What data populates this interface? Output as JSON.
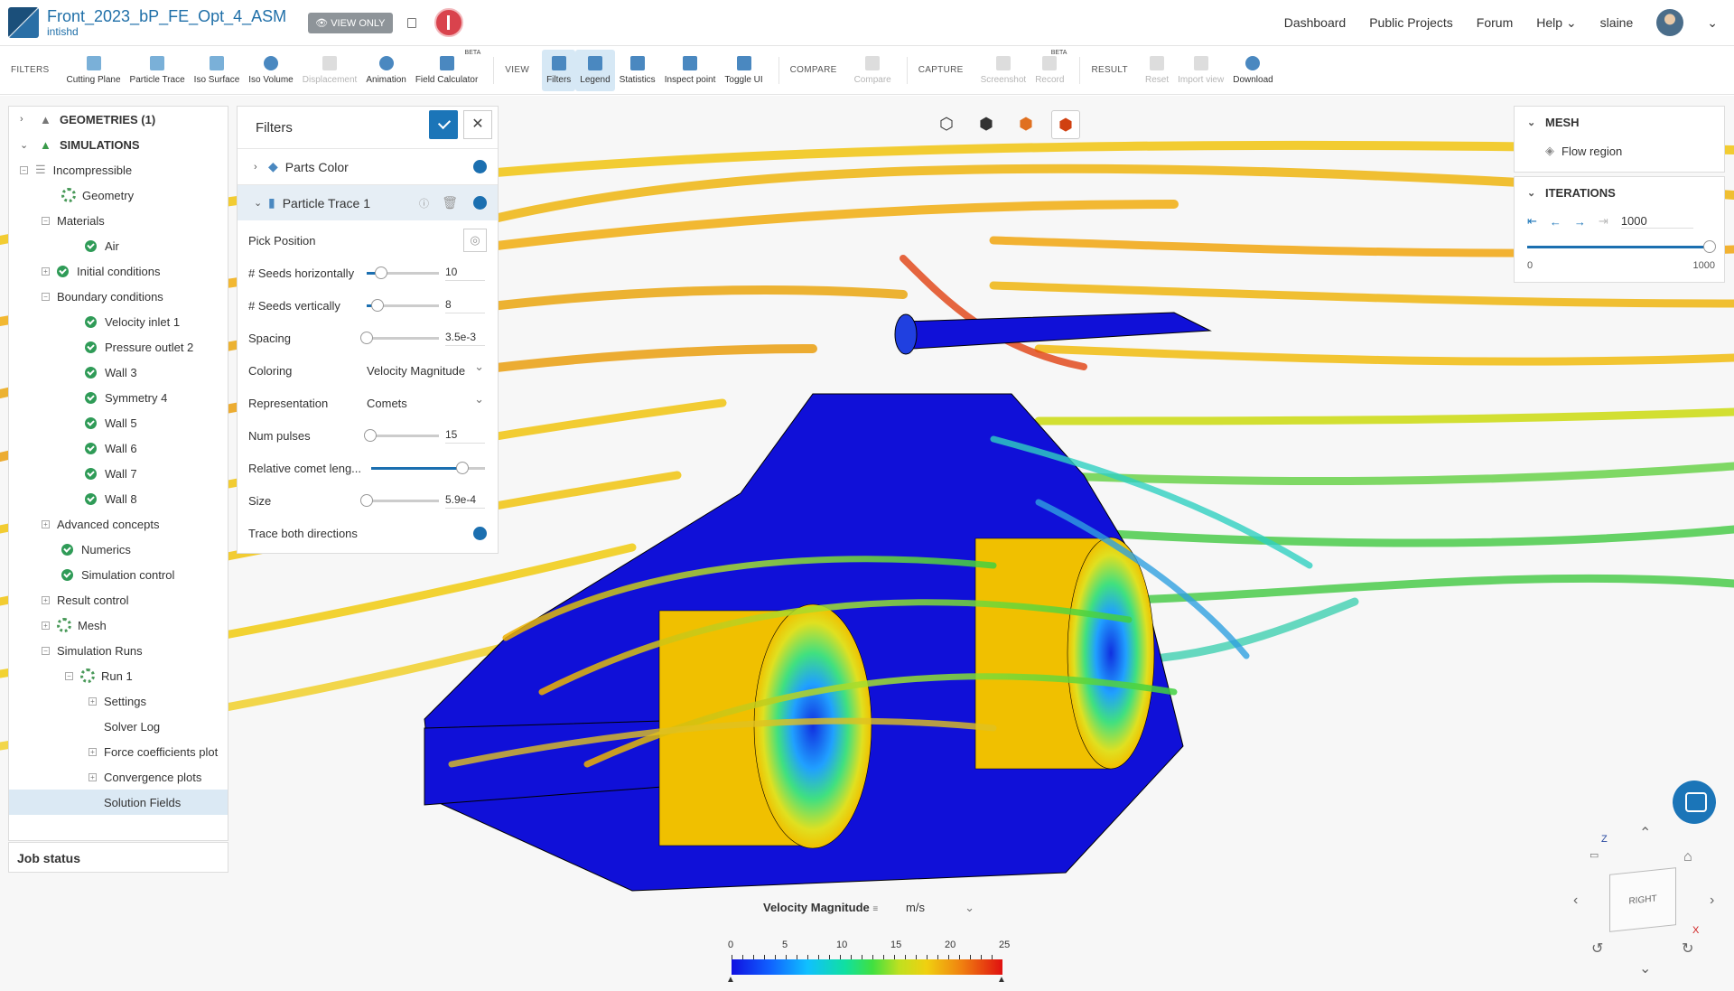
{
  "header": {
    "project_title": "Front_2023_bP_FE_Opt_4_ASM",
    "owner": "intishd",
    "view_only": "VIEW ONLY",
    "nav": [
      "Dashboard",
      "Public Projects",
      "Forum",
      "Help"
    ],
    "username": "slaine"
  },
  "toolbar": {
    "filters_label": "FILTERS",
    "filters": [
      "Cutting Plane",
      "Particle Trace",
      "Iso Surface",
      "Iso Volume",
      "Displacement",
      "Animation",
      "Field Calculator"
    ],
    "view_label": "VIEW",
    "view": [
      "Filters",
      "Legend",
      "Statistics",
      "Inspect point",
      "Toggle UI"
    ],
    "compare_label": "COMPARE",
    "compare": [
      "Compare"
    ],
    "capture_label": "CAPTURE",
    "capture": [
      "Screenshot",
      "Record"
    ],
    "result_label": "RESULT",
    "result": [
      "Reset",
      "Import view",
      "Download"
    ],
    "beta": "BETA"
  },
  "tree": {
    "geometries": "GEOMETRIES (1)",
    "simulations": "SIMULATIONS",
    "items": [
      "Incompressible",
      "Geometry",
      "Materials",
      "Air",
      "Initial conditions",
      "Boundary conditions",
      "Velocity inlet 1",
      "Pressure outlet 2",
      "Wall 3",
      "Symmetry 4",
      "Wall 5",
      "Wall 6",
      "Wall 7",
      "Wall 8",
      "Advanced concepts",
      "Numerics",
      "Simulation control",
      "Result control",
      "Mesh",
      "Simulation Runs",
      "Run 1",
      "Settings",
      "Solver Log",
      "Force coefficients plot",
      "Convergence plots",
      "Solution Fields"
    ],
    "job_status": "Job status"
  },
  "filters_panel": {
    "title": "Filters",
    "parts_color": "Parts Color",
    "particle_trace": "Particle Trace 1",
    "pick_position": "Pick Position",
    "rows": [
      {
        "label": "# Seeds horizontally",
        "value": "10",
        "fraction": 0.2
      },
      {
        "label": "# Seeds vertically",
        "value": "8",
        "fraction": 0.15
      },
      {
        "label": "Spacing",
        "value": "3.5e-3",
        "fraction": 0.0
      }
    ],
    "coloring_label": "Coloring",
    "coloring_value": "Velocity Magnitude",
    "representation_label": "Representation",
    "representation_value": "Comets",
    "num_pulses_label": "Num pulses",
    "num_pulses_value": "15",
    "num_pulses_fraction": 0.05,
    "comet_label": "Relative comet leng...",
    "comet_fraction": 0.8,
    "size_label": "Size",
    "size_value": "5.9e-4",
    "size_fraction": 0.0,
    "trace_both_label": "Trace both directions"
  },
  "right_panel": {
    "mesh_title": "MESH",
    "flow_region": "Flow region",
    "iterations_title": "ITERATIONS",
    "iteration_value": "1000",
    "min": "0",
    "max": "1000",
    "fraction": 1.0
  },
  "legend": {
    "title": "Velocity Magnitude",
    "unit": "m/s",
    "ticks": [
      "0",
      "5",
      "10",
      "15",
      "20",
      "25"
    ]
  },
  "view_cube": {
    "face": "RIGHT",
    "axis_z": "Z",
    "axis_x": "X"
  },
  "colors": {
    "accent": "#1b75b8",
    "body": "#1010d8",
    "wheel": "#f0c400",
    "stream_slow": "#f0b000"
  }
}
